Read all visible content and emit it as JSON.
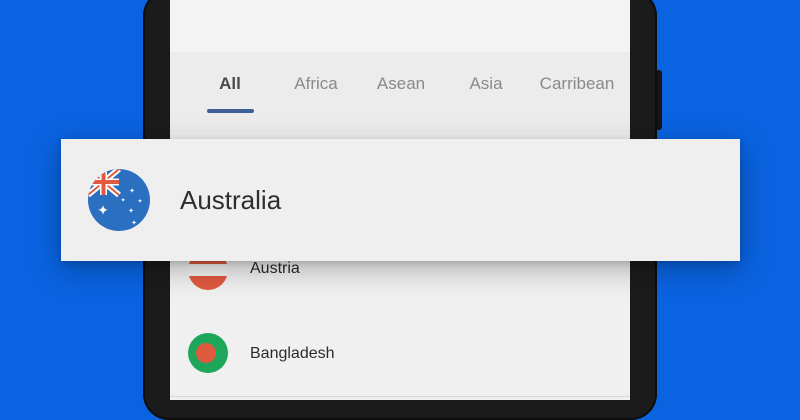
{
  "tabs": {
    "items": [
      {
        "label": "All",
        "active": true
      },
      {
        "label": "Africa",
        "active": false
      },
      {
        "label": "Asean",
        "active": false
      },
      {
        "label": "Asia",
        "active": false
      },
      {
        "label": "Carribean",
        "active": false
      }
    ]
  },
  "highlighted_country": {
    "name": "Australia",
    "flag_icon": "australia-flag-icon"
  },
  "countries": [
    {
      "name": "Austria",
      "flag_icon": "austria-flag-icon"
    },
    {
      "name": "Bangladesh",
      "flag_icon": "bangladesh-flag-icon"
    }
  ],
  "colors": {
    "background": "#0a63e0",
    "tab_indicator": "#3f5f9a",
    "australia_flag_blue": "#2a6fc0",
    "bangladesh_green": "#1ea65a",
    "red": "#e05a40"
  }
}
